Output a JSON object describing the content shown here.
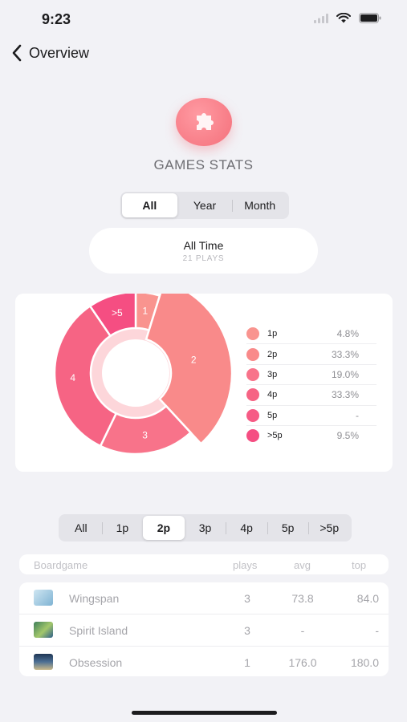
{
  "status_bar": {
    "time": "9:23"
  },
  "nav": {
    "back_label": "Overview"
  },
  "header": {
    "title": "GAMES STATS"
  },
  "period_tabs": [
    {
      "label": "All",
      "active": true
    },
    {
      "label": "Year",
      "active": false
    },
    {
      "label": "Month",
      "active": false
    }
  ],
  "period": {
    "title": "All Time",
    "subtitle": "21 PLAYS"
  },
  "chart_data": {
    "type": "pie",
    "style": "exploded donut",
    "segments": [
      {
        "label": "1",
        "legend": "1p",
        "percent": 4.8,
        "value_text": "4.8%",
        "color": "#f9948f"
      },
      {
        "label": "2",
        "legend": "2p",
        "percent": 33.3,
        "value_text": "33.3%",
        "color": "#f98a8a"
      },
      {
        "label": "3",
        "legend": "3p",
        "percent": 19.0,
        "value_text": "19.0%",
        "color": "#f8738a"
      },
      {
        "label": "4",
        "legend": "4p",
        "percent": 33.3,
        "value_text": "33.3%",
        "color": "#f66484"
      },
      {
        "label": "5",
        "legend": "5p",
        "percent": 0,
        "value_text": "-",
        "color": "#f65b85"
      },
      {
        "label": ">5",
        "legend": ">5p",
        "percent": 9.5,
        "value_text": "9.5%",
        "color": "#f54e82"
      }
    ],
    "selected": "2"
  },
  "player_tabs": [
    {
      "label": "All",
      "active": false
    },
    {
      "label": "1p",
      "active": false
    },
    {
      "label": "2p",
      "active": true
    },
    {
      "label": "3p",
      "active": false
    },
    {
      "label": "4p",
      "active": false
    },
    {
      "label": "5p",
      "active": false
    },
    {
      "label": ">5p",
      "active": false
    }
  ],
  "table": {
    "headers": {
      "name": "Boardgame",
      "plays": "plays",
      "avg": "avg",
      "top": "top"
    },
    "rows": [
      {
        "name": "Wingspan",
        "plays": "3",
        "avg": "73.8",
        "top": "84.0",
        "thumb_color": "#9ec8e0"
      },
      {
        "name": "Spirit Island",
        "plays": "3",
        "avg": "-",
        "top": "-",
        "thumb_color": "#5a9a6a"
      },
      {
        "name": "Obsession",
        "plays": "1",
        "avg": "176.0",
        "top": "180.0",
        "thumb_color": "#2e4a6e"
      }
    ]
  }
}
